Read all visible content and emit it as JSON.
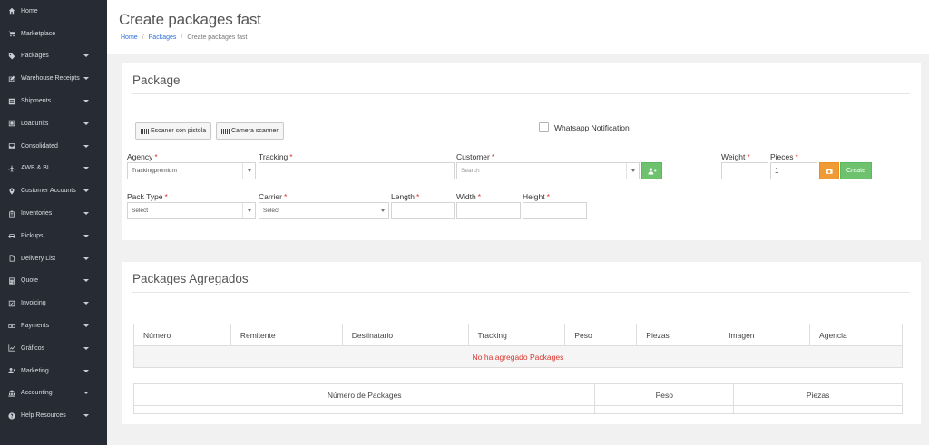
{
  "sidebar": {
    "items": [
      {
        "label": "Home",
        "icon": "home-icon",
        "has_caret": false
      },
      {
        "label": "Marketplace",
        "icon": "cart-icon",
        "has_caret": false
      },
      {
        "label": "Packages",
        "icon": "tag-icon",
        "has_caret": true
      },
      {
        "label": "Warehouse Receipts",
        "icon": "edit-icon",
        "has_caret": true
      },
      {
        "label": "Shipments",
        "icon": "list-icon",
        "has_caret": true
      },
      {
        "label": "Loadunits",
        "icon": "box-icon",
        "has_caret": true
      },
      {
        "label": "Consolidated",
        "icon": "inbox-icon",
        "has_caret": true
      },
      {
        "label": "AWB & BL",
        "icon": "plane-icon",
        "has_caret": true
      },
      {
        "label": "Customer Accounts",
        "icon": "pin-icon",
        "has_caret": true
      },
      {
        "label": "Inventories",
        "icon": "clipboard-icon",
        "has_caret": true
      },
      {
        "label": "Pickups",
        "icon": "car-icon",
        "has_caret": true
      },
      {
        "label": "Delivery List",
        "icon": "doc-icon",
        "has_caret": true
      },
      {
        "label": "Quote",
        "icon": "calc-icon",
        "has_caret": true
      },
      {
        "label": "Invoicing",
        "icon": "check-icon",
        "has_caret": true
      },
      {
        "label": "Payments",
        "icon": "money-icon",
        "has_caret": true
      },
      {
        "label": "Gráficos",
        "icon": "chart-icon",
        "has_caret": true
      },
      {
        "label": "Marketing",
        "icon": "users-icon",
        "has_caret": true
      },
      {
        "label": "Accounting",
        "icon": "bank-icon",
        "has_caret": true
      },
      {
        "label": "Help Resources",
        "icon": "help-icon",
        "has_caret": true
      }
    ]
  },
  "header": {
    "title": "Create packages fast",
    "breadcrumb": {
      "home": "Home",
      "packages": "Packages",
      "current": "Create packages fast",
      "separator": "/"
    }
  },
  "package_card": {
    "title": "Package",
    "scan_button": "Escaner con pistola",
    "camera_button": "Camera scanner",
    "whatsapp_label": "Whatsapp Notification",
    "required_mark": "*",
    "labels": {
      "agency": "Agency",
      "tracking": "Tracking",
      "customer": "Customer",
      "weight": "Weight",
      "pieces": "Pieces",
      "pack_type": "Pack Type",
      "carrier": "Carrier",
      "length": "Length",
      "width": "Width",
      "height": "Height"
    },
    "values": {
      "agency": "Trackingpremium",
      "tracking": "",
      "customer_placeholder": "Search",
      "weight": "",
      "pieces": "1",
      "pack_type": "Select",
      "carrier": "Select",
      "length": "",
      "width": "",
      "height": ""
    },
    "create_button": "Create"
  },
  "added_card": {
    "title": "Packages Agregados",
    "columns": [
      "Número",
      "Remitente",
      "Destinatario",
      "Tracking",
      "Peso",
      "Piezas",
      "Imagen",
      "Agencia"
    ],
    "empty_message": "No ha agregado Packages",
    "summary_columns": [
      "Número de Packages",
      "Peso",
      "Piezas"
    ]
  },
  "colors": {
    "sidebar_bg": "#272b33",
    "green": "#6ec26e",
    "orange": "#f09a35",
    "required": "#d9362f",
    "link": "#2a6fdb"
  }
}
